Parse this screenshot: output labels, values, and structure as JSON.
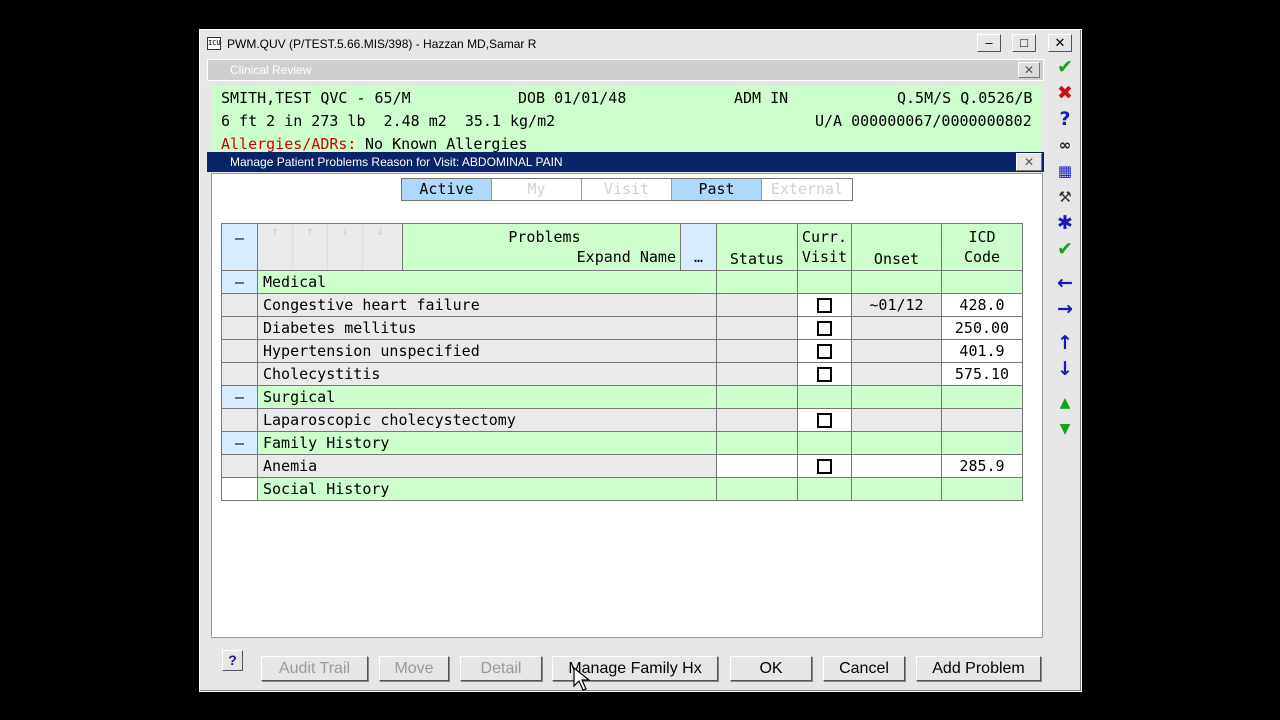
{
  "window": {
    "title": "PWM.QUV (P/TEST.5.66.MIS/398) - Hazzan MD,Samar R",
    "app_icon_text": "ICU",
    "minimize": "–",
    "maximize": "□",
    "close": "✕"
  },
  "clinical_review": {
    "title": "Clinical Review",
    "close": "✕"
  },
  "patient": {
    "name_age": "SMITH,TEST QVC - 65/M",
    "dob": "DOB 01/01/48",
    "status": "ADM IN",
    "room": "Q.5M/S Q.0526/B",
    "vitals": "6 ft 2 in 273 lb  2.48 m2  35.1 kg/m2",
    "account": "U/A 000000067/0000000802",
    "allergy_label": "Allergies/ADRs:",
    "allergy_value": "No Known Allergies",
    "allergy_color": "#d00000"
  },
  "manage_problems": {
    "title": "Manage Patient Problems   Reason for Visit: ABDOMINAL PAIN",
    "close": "✕"
  },
  "tabs": [
    {
      "label": "Active",
      "state": "selected"
    },
    {
      "label": "My",
      "state": "disabled"
    },
    {
      "label": "Visit",
      "state": "disabled"
    },
    {
      "label": "Past",
      "state": "selected"
    },
    {
      "label": "External",
      "state": "disabled"
    }
  ],
  "grid": {
    "header": {
      "collapse": "–",
      "problems": "Problems",
      "expand_name": "Expand Name",
      "ellipsis": "…",
      "status": "Status",
      "curr": "Curr.",
      "visit": "Visit",
      "onset": "Onset",
      "icd": "ICD",
      "code": "Code"
    },
    "rows": [
      {
        "kind": "group",
        "toggle": "–",
        "label": "Medical"
      },
      {
        "kind": "item",
        "label": "Congestive heart failure",
        "onset": "~01/12",
        "icd": "428.0"
      },
      {
        "kind": "item",
        "label": "Diabetes mellitus",
        "onset": "",
        "icd": "250.00"
      },
      {
        "kind": "item",
        "label": "Hypertension unspecified",
        "onset": "",
        "icd": "401.9"
      },
      {
        "kind": "item",
        "label": "Cholecystitis",
        "onset": "",
        "icd": "575.10"
      },
      {
        "kind": "group",
        "toggle": "–",
        "label": "Surgical"
      },
      {
        "kind": "item",
        "label": "Laparoscopic cholecystectomy",
        "onset": "",
        "icd": ""
      },
      {
        "kind": "group",
        "toggle": "–",
        "label": "Family History"
      },
      {
        "kind": "item",
        "label": "Anemia",
        "onset": "",
        "icd": "285.9"
      },
      {
        "kind": "group",
        "toggle": "",
        "label": "Social History"
      }
    ]
  },
  "buttons": {
    "help": "?",
    "audit_trail": "Audit Trail",
    "move": "Move",
    "detail": "Detail",
    "manage_family": "Manage Family Hx",
    "ok": "OK",
    "cancel": "Cancel",
    "add_problem": "Add Problem"
  },
  "toolbar": [
    "check-icon",
    "cross-icon",
    "help-icon",
    "binoculars-icon",
    "grid-edit-icon",
    "tools-icon",
    "asterisk-icon",
    "check-all-icon",
    "arrow-left-icon",
    "arrow-right-icon",
    "arrow-up-icon",
    "arrow-down-icon",
    "triangle-up-icon",
    "triangle-down-icon"
  ]
}
